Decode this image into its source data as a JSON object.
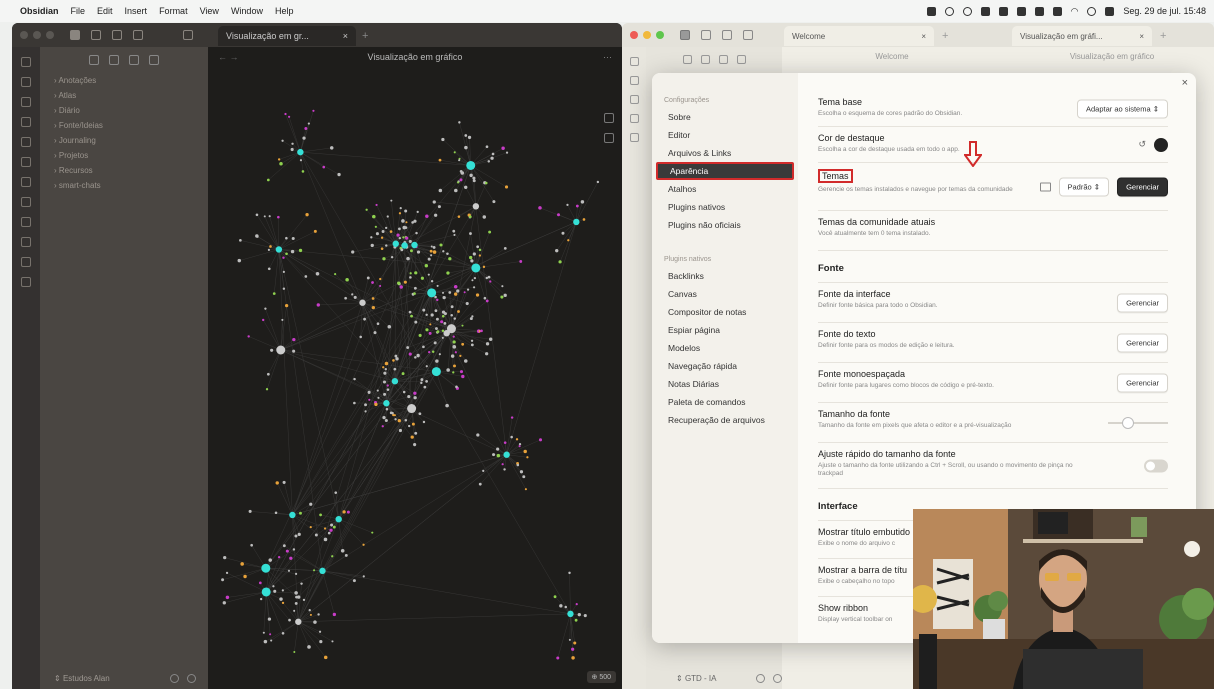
{
  "menubar": {
    "app": "Obsidian",
    "items": [
      "File",
      "Edit",
      "Insert",
      "Format",
      "View",
      "Window",
      "Help"
    ],
    "clock": "Seg. 29 de jul. 15:48"
  },
  "left_window": {
    "tab_title": "Visualização em gr...",
    "pane_title": "Visualização em gráfico",
    "folders": [
      "Anotações",
      "Atlas",
      "Diário",
      "Fonte/Ideias",
      "Journaling",
      "Projetos",
      "Recursos",
      "smart-chats"
    ],
    "vault_name": "Estudos Alan",
    "badge": "500"
  },
  "right_window": {
    "tabs": [
      {
        "title": "Welcome"
      },
      {
        "title": "Visualização em gráfi..."
      }
    ],
    "pane_heads": [
      "Welcome",
      "Visualização em gráfico"
    ],
    "vault_name": "GTD - IA"
  },
  "settings": {
    "nav_group_1": "Configurações",
    "nav_items_1": [
      "Sobre",
      "Editor",
      "Arquivos & Links",
      "Aparência",
      "Atalhos",
      "Plugins nativos",
      "Plugins não oficiais"
    ],
    "active_item": "Aparência",
    "nav_group_2": "Plugins nativos",
    "nav_items_2": [
      "Backlinks",
      "Canvas",
      "Compositor de notas",
      "Espiar página",
      "Modelos",
      "Navegação rápida",
      "Notas Diárias",
      "Paleta de comandos",
      "Recuperação de arquivos"
    ],
    "rows": {
      "tema_base": {
        "name": "Tema base",
        "desc": "Escolha o esquema de cores padrão do Obsidian.",
        "value": "Adaptar ao sistema"
      },
      "cor_destaque": {
        "name": "Cor de destaque",
        "desc": "Escolha a cor de destaque usada em todo o app.",
        "color": "#222222"
      },
      "temas": {
        "name": "Temas",
        "desc": "Gerencie os temas instalados e navegue por temas da comunidade",
        "select": "Padrão",
        "button": "Gerenciar"
      },
      "temas_comunidade": {
        "name": "Temas da comunidade atuais",
        "desc": "Você atualmente tem 0 tema instalado."
      }
    },
    "section_fonte": "Fonte",
    "font_rows": {
      "interface": {
        "name": "Fonte da interface",
        "desc": "Definir fonte básica para todo o Obsidian.",
        "button": "Gerenciar"
      },
      "texto": {
        "name": "Fonte do texto",
        "desc": "Definir fonte para os modos de edição e leitura.",
        "button": "Gerenciar"
      },
      "mono": {
        "name": "Fonte monoespaçada",
        "desc": "Definir fonte para lugares como blocos de código e pré-texto.",
        "button": "Gerenciar"
      },
      "tamanho": {
        "name": "Tamanho da fonte",
        "desc": "Tamanho da fonte em pixels que afeta o editor e a pré-visualização",
        "level": 0.3
      },
      "ajuste": {
        "name": "Ajuste rápido do tamanho da fonte",
        "desc": "Ajuste o tamanho da fonte utilizando a Ctrl + Scroll, ou usando o movimento de pinça no trackpad",
        "enabled": false
      }
    },
    "section_interface": "Interface",
    "interface_rows": {
      "titulo": {
        "name": "Mostrar título embutido",
        "desc": "Exibe o nome do arquivo c"
      },
      "barra": {
        "name": "Mostrar a barra de títu",
        "desc": "Exibe o cabeçalho no topo"
      },
      "ribbon": {
        "name": "Show ribbon",
        "desc": "Display vertical toolbar on"
      }
    }
  },
  "colors": {
    "accent_red": "#d12b2b",
    "graph_cyan": "#35e0d6",
    "graph_orange": "#e8a23a",
    "graph_magenta": "#c83cc8"
  }
}
